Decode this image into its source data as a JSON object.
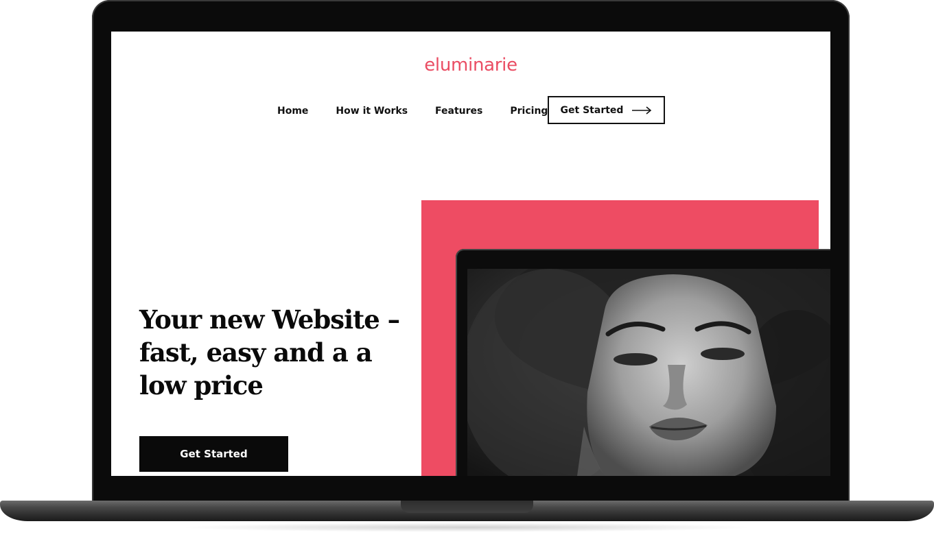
{
  "site": {
    "brand": "eluminarie",
    "brand_color": "#ea4d63",
    "accent_color": "#ee4c63"
  },
  "nav": {
    "items": [
      {
        "label": "Home"
      },
      {
        "label": "How it Works"
      },
      {
        "label": "Features"
      },
      {
        "label": "Pricing"
      }
    ],
    "cta_label": "Get Started",
    "cta_icon": "arrow-right-icon"
  },
  "hero": {
    "title": "Your new Website – fast, easy and a a low price",
    "cta_label": "Get Started",
    "image": "portrait-photo"
  }
}
